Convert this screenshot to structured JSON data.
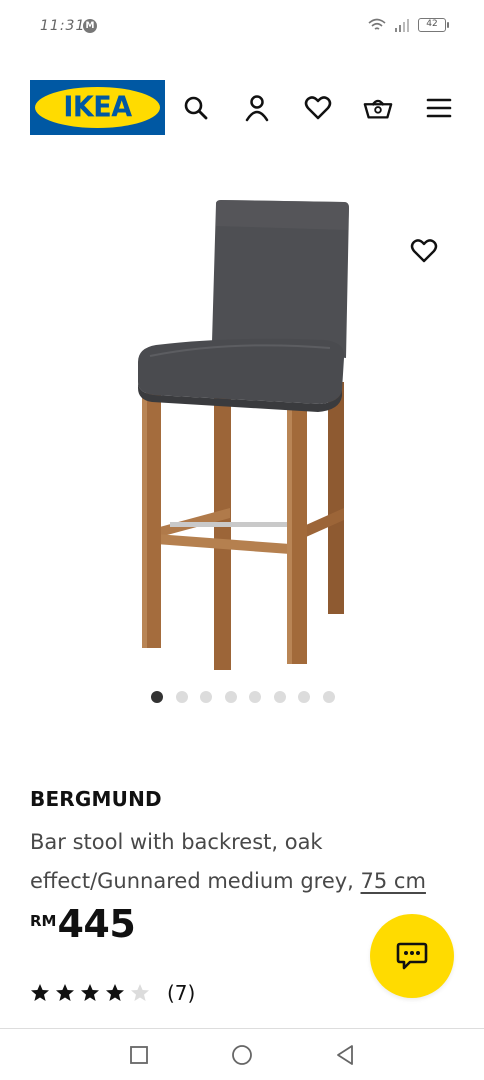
{
  "status_bar": {
    "time": "11:31",
    "notification_icon": "m-icon",
    "battery": "42"
  },
  "header": {
    "logo_text": "IKEA",
    "icons": [
      "search-icon",
      "account-icon",
      "wishlist-heart-icon",
      "cart-basket-icon",
      "menu-icon"
    ]
  },
  "gallery": {
    "image_count": 8,
    "active_index": 0
  },
  "product": {
    "name": "BERGMUND",
    "description": "Bar stool with backrest, oak effect/Gunnared medium grey,",
    "size_link": "75 cm",
    "currency": "RM",
    "price": "445",
    "rating": 4,
    "rating_max": 5,
    "review_count": "(7)"
  },
  "colors": {
    "ikea_blue": "#0058a3",
    "ikea_yellow": "#ffdb00"
  },
  "nav_bar": {
    "icons": [
      "recents-square-icon",
      "home-circle-icon",
      "back-triangle-icon"
    ]
  }
}
